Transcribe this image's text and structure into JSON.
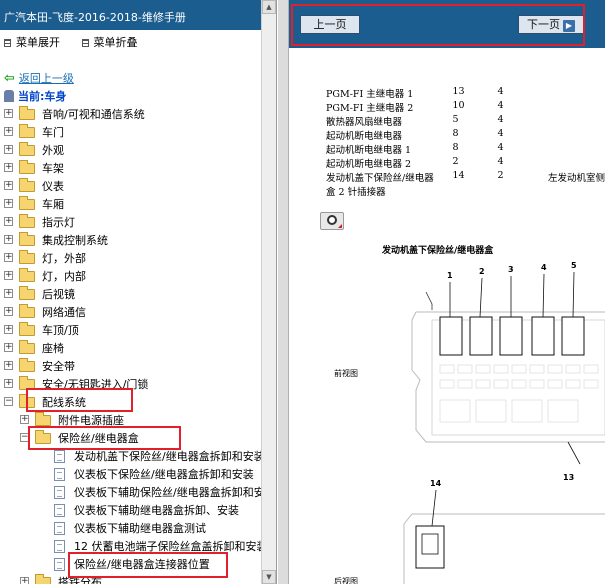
{
  "left_panel": {
    "title": "广汽本田-飞度-2016-2018-维修手册",
    "menu_expand": "菜单展开",
    "menu_collapse": "菜单折叠",
    "back_link": "返回上一级",
    "current_label": "当前:车身",
    "tree_items": [
      "音响/可视和通信系统",
      "车门",
      "外观",
      "车架",
      "仪表",
      "车厢",
      "指示灯",
      "集成控制系统",
      "灯，外部",
      "灯，内部",
      "后视镜",
      "网络通信",
      "车顶/顶",
      "座椅",
      "安全带",
      "安全/无钥匙进入/门锁",
      "配线系统",
      "附件电源插座",
      "保险丝/继电器盒",
      "发动机盖下保险丝/继电器盒拆卸和安装",
      "仪表板下保险丝/继电器盒拆卸和安装",
      "仪表板下辅助保险丝/继电器盒拆卸和安装",
      "仪表板下辅助继电器盒拆卸、安装",
      "仪表板下辅助继电器盒测试",
      "12 伏蓄电池端子保险丝盒盖拆卸和安装",
      "保险丝/继电器盒连接器位置",
      "搭铁分布"
    ]
  },
  "right_panel": {
    "prev_label": "上一页",
    "next_label": "下一页",
    "table_rows": [
      {
        "name": "PGM-FI 主继电器 1",
        "a": "13",
        "b": "4",
        "note": ""
      },
      {
        "name": "PGM-FI 主继电器 2",
        "a": "10",
        "b": "4",
        "note": ""
      },
      {
        "name": "散热器风扇继电器",
        "a": "5",
        "b": "4",
        "note": ""
      },
      {
        "name": "起动机断电继电器",
        "a": "8",
        "b": "4",
        "note": ""
      },
      {
        "name": "起动机断电继电器 1",
        "a": "8",
        "b": "4",
        "note": ""
      },
      {
        "name": "起动机断电继电器 2",
        "a": "2",
        "b": "4",
        "note": ""
      },
      {
        "name": "发动机盖下保险丝/继电器",
        "a": "14",
        "b": "2",
        "note": "左发动机室侧"
      },
      {
        "name": "盒 2 针插接器",
        "a": "",
        "b": "",
        "note": ""
      }
    ],
    "diagram_title": "发动机盖下保险丝/继电器盒",
    "front_view": "前视图",
    "side_view": "后视图",
    "callouts": [
      "1",
      "2",
      "3",
      "4",
      "5",
      "13",
      "14"
    ]
  },
  "colors": {
    "header_blue": "#1c5d8f",
    "highlight_red": "#e0202a",
    "folder_yellow": "#f6d470",
    "link_blue": "#1a6fb3"
  }
}
